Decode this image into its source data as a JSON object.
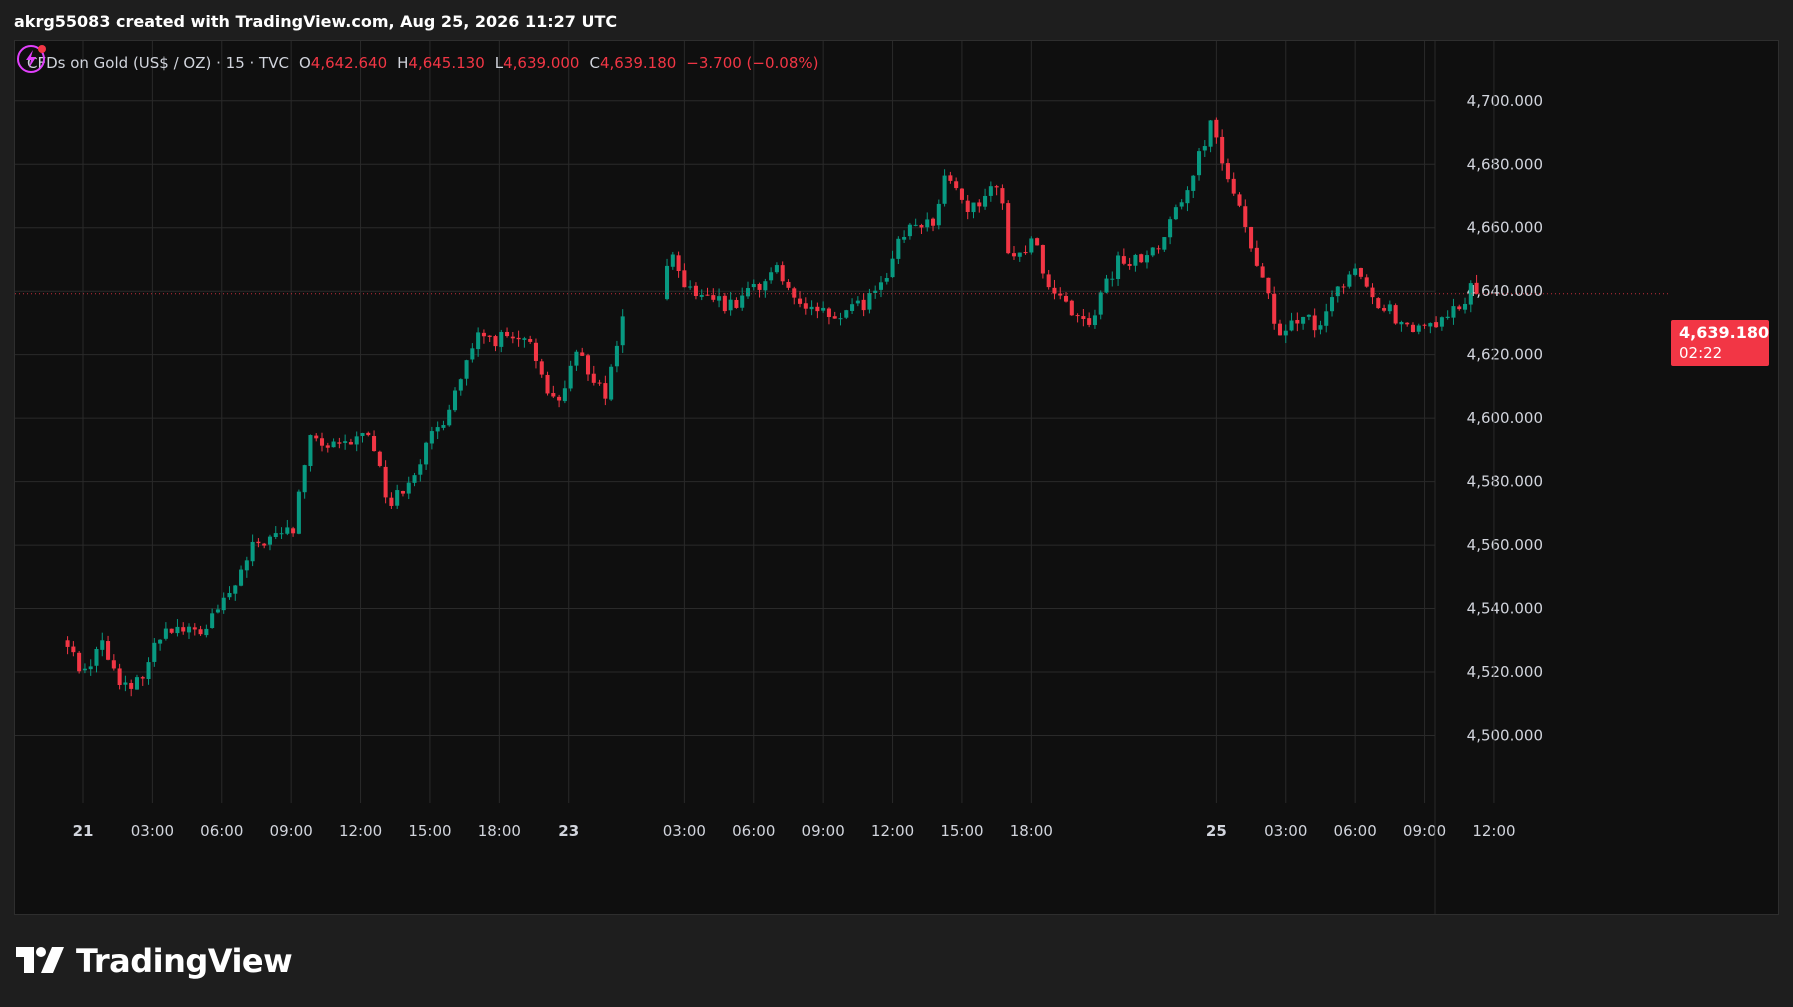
{
  "credit_line": "akrg55083 created with TradingView.com, Aug 25, 2026 11:27 UTC",
  "legend": {
    "symbol": "CFDs on Gold (US$ / OZ) · 15 · TVC",
    "o_label": "O",
    "o_value": "4,642.640",
    "h_label": "H",
    "h_value": "4,645.130",
    "l_label": "L",
    "l_value": "4,639.000",
    "c_label": "C",
    "c_value": "4,639.180",
    "change": "−3.700 (−0.08%)"
  },
  "last_price": {
    "price": "4,639.180",
    "countdown": "02:22"
  },
  "brand": {
    "name": "TradingView"
  },
  "colors": {
    "up": "#089981",
    "down": "#f23645",
    "grid": "#2a2a2a",
    "axis_text": "#d1d4dc",
    "background": "#0f0f0f",
    "accent": "#e040fb"
  },
  "icons": {
    "alert": "bolt-icon",
    "logo": "tradingview-logo-icon"
  },
  "chart_data": {
    "type": "candlestick",
    "title": "CFDs on Gold (US$ / OZ) · 15 · TVC",
    "xlabel": "",
    "ylabel": "",
    "ylim": [
      4488,
      4718
    ],
    "y_ticks": [
      4500,
      4520,
      4540,
      4560,
      4580,
      4600,
      4620,
      4640,
      4660,
      4680,
      4700
    ],
    "y_tick_labels": [
      "4,500.000",
      "4,520.000",
      "4,540.000",
      "4,560.000",
      "4,580.000",
      "4,600.000",
      "4,620.000",
      "4,640.000",
      "4,660.000",
      "4,680.000",
      "4,700.000"
    ],
    "x_range": [
      -40,
      1415
    ],
    "x_ticks": [
      {
        "label": "21",
        "t": 0,
        "bold": true
      },
      {
        "label": "03:00",
        "t": 180
      },
      {
        "label": "06:00",
        "t": 360
      },
      {
        "label": "09:00",
        "t": 540
      },
      {
        "label": "12:00",
        "t": 720
      },
      {
        "label": "15:00",
        "t": 900
      },
      {
        "label": "18:00",
        "t": 1080
      },
      {
        "label": "23",
        "t": 1260,
        "bold": true
      },
      {
        "label": "03:00",
        "t": 1560
      },
      {
        "label": "06:00",
        "t": 1740
      },
      {
        "label": "09:00",
        "t": 1920
      },
      {
        "label": "12:00",
        "t": 2100
      },
      {
        "label": "15:00",
        "t": 2280
      },
      {
        "label": "18:00",
        "t": 2460
      },
      {
        "label": "25",
        "t": 2940,
        "bold": true
      },
      {
        "label": "03:00",
        "t": 3120
      },
      {
        "label": "06:00",
        "t": 3300
      },
      {
        "label": "09:00",
        "t": 3480
      },
      {
        "label": "12:00",
        "t": 3660
      }
    ],
    "anchors": [
      {
        "t": -40,
        "p": 4530
      },
      {
        "t": 20,
        "p": 4520
      },
      {
        "t": 60,
        "p": 4530
      },
      {
        "t": 90,
        "p": 4522
      },
      {
        "t": 140,
        "p": 4513
      },
      {
        "t": 230,
        "p": 4535
      },
      {
        "t": 320,
        "p": 4532
      },
      {
        "t": 400,
        "p": 4545
      },
      {
        "t": 460,
        "p": 4560
      },
      {
        "t": 560,
        "p": 4565
      },
      {
        "t": 600,
        "p": 4593
      },
      {
        "t": 680,
        "p": 4590
      },
      {
        "t": 760,
        "p": 4596
      },
      {
        "t": 810,
        "p": 4572
      },
      {
        "t": 880,
        "p": 4585
      },
      {
        "t": 950,
        "p": 4600
      },
      {
        "t": 1040,
        "p": 4625
      },
      {
        "t": 1120,
        "p": 4625
      },
      {
        "t": 1180,
        "p": 4622
      },
      {
        "t": 1240,
        "p": 4604
      },
      {
        "t": 1300,
        "p": 4620
      },
      {
        "t": 1370,
        "p": 4608
      },
      {
        "t": 1420,
        "p": 4634
      },
      {
        "t": 1480,
        "p": 4613
      },
      {
        "t": 1540,
        "p": 4655
      },
      {
        "t": 1570,
        "p": 4640
      },
      {
        "t": 1700,
        "p": 4635
      },
      {
        "t": 1820,
        "p": 4647
      },
      {
        "t": 1900,
        "p": 4633
      },
      {
        "t": 2000,
        "p": 4633
      },
      {
        "t": 2080,
        "p": 4640
      },
      {
        "t": 2150,
        "p": 4660
      },
      {
        "t": 2230,
        "p": 4663
      },
      {
        "t": 2250,
        "p": 4676
      },
      {
        "t": 2320,
        "p": 4665
      },
      {
        "t": 2390,
        "p": 4675
      },
      {
        "t": 2420,
        "p": 4650
      },
      {
        "t": 2480,
        "p": 4655
      },
      {
        "t": 2540,
        "p": 4638
      },
      {
        "t": 2620,
        "p": 4630
      },
      {
        "t": 2700,
        "p": 4649
      },
      {
        "t": 2800,
        "p": 4652
      },
      {
        "t": 2860,
        "p": 4668
      },
      {
        "t": 2940,
        "p": 4692
      },
      {
        "t": 2980,
        "p": 4677
      },
      {
        "t": 3060,
        "p": 4650
      },
      {
        "t": 3120,
        "p": 4624
      },
      {
        "t": 3180,
        "p": 4633
      },
      {
        "t": 3220,
        "p": 4626
      },
      {
        "t": 3280,
        "p": 4643
      },
      {
        "t": 3330,
        "p": 4646
      },
      {
        "t": 3370,
        "p": 4637
      },
      {
        "t": 3460,
        "p": 4628
      },
      {
        "t": 3540,
        "p": 4630
      },
      {
        "t": 3600,
        "p": 4638
      },
      {
        "t": 3620,
        "p": 4642.64
      }
    ],
    "candle_interval_minutes": 15,
    "last_candle": {
      "o": 4642.64,
      "h": 4645.13,
      "l": 4639.0,
      "c": 4639.18
    },
    "last_price": 4639.18
  }
}
